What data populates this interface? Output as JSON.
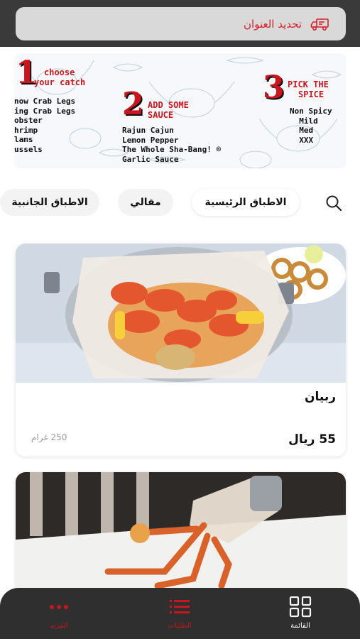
{
  "header": {
    "address_label": "تحديد العنوان",
    "truck_icon": "delivery-truck-icon"
  },
  "banner": {
    "step1": {
      "num": "1",
      "title_line1": "choose",
      "title_line2": "your catch",
      "items": "now Crab Legs\ning Crab Legs\nobster\nhrimp\nlams\nussels"
    },
    "step2": {
      "num": "2",
      "title_line1": "ADD SOME",
      "title_line2": "SAUCE",
      "items": "Rajun Cajun\nLemon Pepper\nThe Whole Sha-Bang! ®\nGarlic Sauce"
    },
    "step3": {
      "num": "3",
      "title_line1": "PICK THE",
      "title_line2": "SPICE",
      "items": "Non Spicy\n  Mild\n  Med\n  XXX"
    }
  },
  "categories": {
    "items": [
      "الاطباق الرئيسية",
      "مقالي",
      "الاطباق الجانبية"
    ],
    "active_index": 0
  },
  "dishes": [
    {
      "name": "ربيان",
      "price": "55 ريال",
      "weight": "250 غرام"
    }
  ],
  "nav": {
    "menu_label": "القائمة",
    "orders_label": "الطلبات",
    "more_label": "المزيد"
  },
  "colors": {
    "accent": "#c8161e",
    "header_bg": "#3a3a3a",
    "nav_bg": "#2f2f2f"
  }
}
